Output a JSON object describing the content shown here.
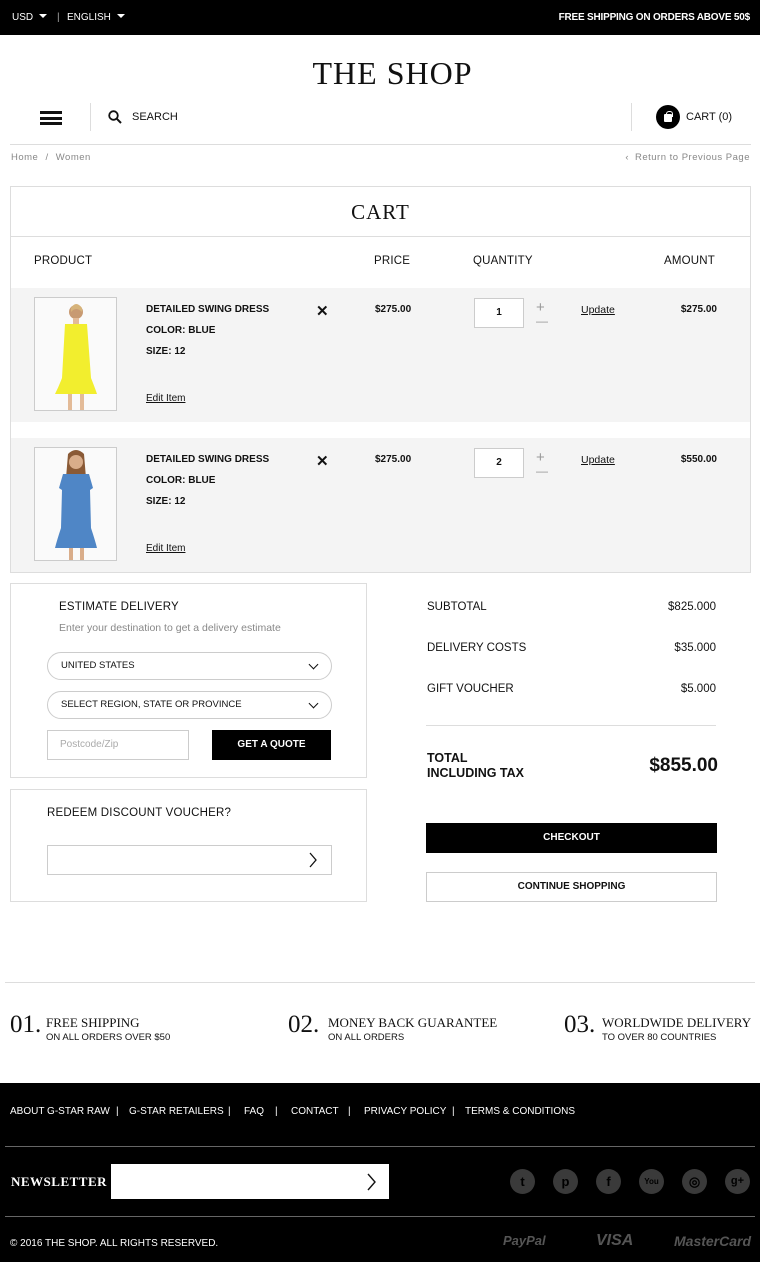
{
  "topbar": {
    "currency": "USD",
    "separator": "|",
    "language": "ENGLISH",
    "shipping": "FREE SHIPPING ON ORDERS ABOVE 50$"
  },
  "header": {
    "logo": "THE SHOP",
    "search_placeholder": "SEARCH",
    "cart_label": "CART (0)"
  },
  "breadcrumb": {
    "home": "Home",
    "sep": "/",
    "current": "Women",
    "back": "Return to Previous Page"
  },
  "cart": {
    "title": "CART",
    "headers": {
      "product": "PRODUCT",
      "price": "PRICE",
      "quantity": "QUANTITY",
      "amount": "AMOUNT"
    },
    "items": [
      {
        "name": "DETAILED SWING DRESS",
        "color": "COLOR: BLUE",
        "size": "SIZE: 12",
        "edit": "Edit Item",
        "remove": "✕",
        "price": "$275.00",
        "qty": "1",
        "plus": "+",
        "minus": "—",
        "update": "Update",
        "amount": "$275.00",
        "dress_color": "#f2ee2e"
      },
      {
        "name": "DETAILED SWING DRESS",
        "color": "COLOR: BLUE",
        "size": "SIZE: 12",
        "edit": "Edit Item",
        "remove": "✕",
        "price": "$275.00",
        "qty": "2",
        "plus": "+",
        "minus": "—",
        "update": "Update",
        "amount": "$550.00",
        "dress_color": "#4f86c6"
      }
    ]
  },
  "delivery": {
    "title": "ESTIMATE DELIVERY",
    "subtitle": "Enter your destination to get a delivery estimate",
    "country": "UNITED STATES",
    "region": "SELECT REGION, STATE OR PROVINCE",
    "postcode_placeholder": "Postcode/Zip",
    "quote_button": "GET A QUOTE"
  },
  "voucher": {
    "title": "REDEEM DISCOUNT VOUCHER?"
  },
  "summary": {
    "subtotal_label": "SUBTOTAL",
    "subtotal": "$825.000",
    "delivery_label": "DELIVERY COSTS",
    "delivery": "$35.000",
    "voucher_label": "GIFT VOUCHER",
    "voucher": "$5.000",
    "total_label_1": "TOTAL",
    "total_label_2": "INCLUDING TAX",
    "total": "$855.00",
    "checkout": "CHECKOUT",
    "continue": "CONTINUE SHOPPING"
  },
  "features": [
    {
      "num": "01.",
      "title": "FREE SHIPPING",
      "sub": "ON ALL ORDERS OVER $50"
    },
    {
      "num": "02.",
      "title": "MONEY BACK GUARANTEE",
      "sub": "ON ALL ORDERS"
    },
    {
      "num": "03.",
      "title": "WORLDWIDE DELIVERY",
      "sub": "TO OVER 80 COUNTRIES"
    }
  ],
  "footer": {
    "links": [
      "ABOUT G-STAR RAW",
      "G-STAR RETAILERS",
      "FAQ",
      "CONTACT",
      "PRIVACY POLICY",
      "TERMS & CONDITIONS"
    ],
    "link_sep": "|",
    "newsletter": "NEWSLETTER",
    "social": [
      "twitter-icon",
      "pinterest-icon",
      "facebook-icon",
      "youtube-icon",
      "instagram-icon",
      "google-plus-icon"
    ],
    "copyright": "© 2016 THE SHOP. ALL RIGHTS RESERVED.",
    "payments": [
      "PayPal",
      "VISA",
      "MasterCard"
    ]
  }
}
